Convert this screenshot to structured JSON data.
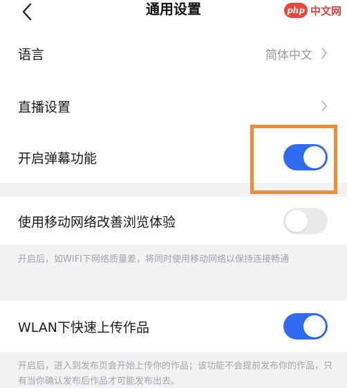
{
  "header": {
    "title": "通用设置",
    "back_icon": "chevron-left-icon"
  },
  "watermark": {
    "logo_text": "php",
    "site_text": "中文网"
  },
  "settings": {
    "language": {
      "label": "语言",
      "value": "简体中文"
    },
    "live": {
      "label": "直播设置"
    },
    "danmaku": {
      "label": "开启弹幕功能",
      "enabled": true
    },
    "mobile_network": {
      "label": "使用移动网络改善浏览体验",
      "enabled": false,
      "note": "开启后，如WIFI下网络质量差，将同时使用移动网络以保持连接畅通"
    },
    "wlan_upload": {
      "label": "WLAN下快速上传作品",
      "enabled": true,
      "note": "开启后，进入到发布页会开始上传你的作品；该功能不会提前发布你的作品，只有当你确认发布后作品才可能发布出去。"
    }
  },
  "colors": {
    "toggle_on": "#2f6cf0",
    "toggle_off": "#e9e9ec",
    "highlight": "#ef8a36",
    "background": "#f2f2f5"
  }
}
